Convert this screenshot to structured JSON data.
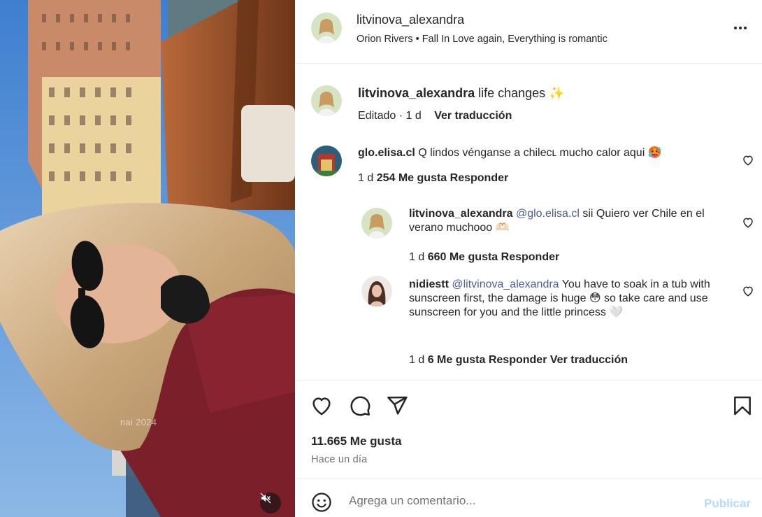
{
  "media": {
    "overlay_text": "nai 2024",
    "mute_icon": "speaker-muted-icon"
  },
  "header": {
    "username": "litvinova_alexandra",
    "subtitle": "Orion Rivers • Fall In Love again, Everything is romantic",
    "more_icon": "more-options-icon"
  },
  "caption": {
    "username": "litvinova_alexandra",
    "text": "life changes ✨",
    "edited": "Editado · 1 d",
    "translate": "Ver traducción"
  },
  "comments": [
    {
      "username": "glo.elisa.cl",
      "text": "Q lindos vénganse a chileᴄʟ mucho calor aqui 🥵",
      "age": "1 d",
      "likes": "254 Me gusta",
      "reply": "Responder"
    },
    {
      "username": "litvinova_alexandra",
      "mention": "@glo.elisa.cl",
      "text": "sii Quiero ver Chile en el verano muchooo 🫶🏻",
      "age": "1 d",
      "likes": "660 Me gusta",
      "reply": "Responder"
    },
    {
      "username": "nidiestt",
      "mention": "@litvinova_alexandra",
      "text": "You have to soak in a tub with sunscreen first, the damage is huge 😳 so take care and use sunscreen for you and the little princess 🤍",
      "age": "1 d",
      "likes": "6 Me gusta",
      "reply": "Responder",
      "translate": "Ver traducción"
    }
  ],
  "actions": {
    "likes": "11.665 Me gusta",
    "time_ago": "Hace un día"
  },
  "composer": {
    "placeholder": "Agrega un comentario...",
    "publish": "Publicar"
  }
}
